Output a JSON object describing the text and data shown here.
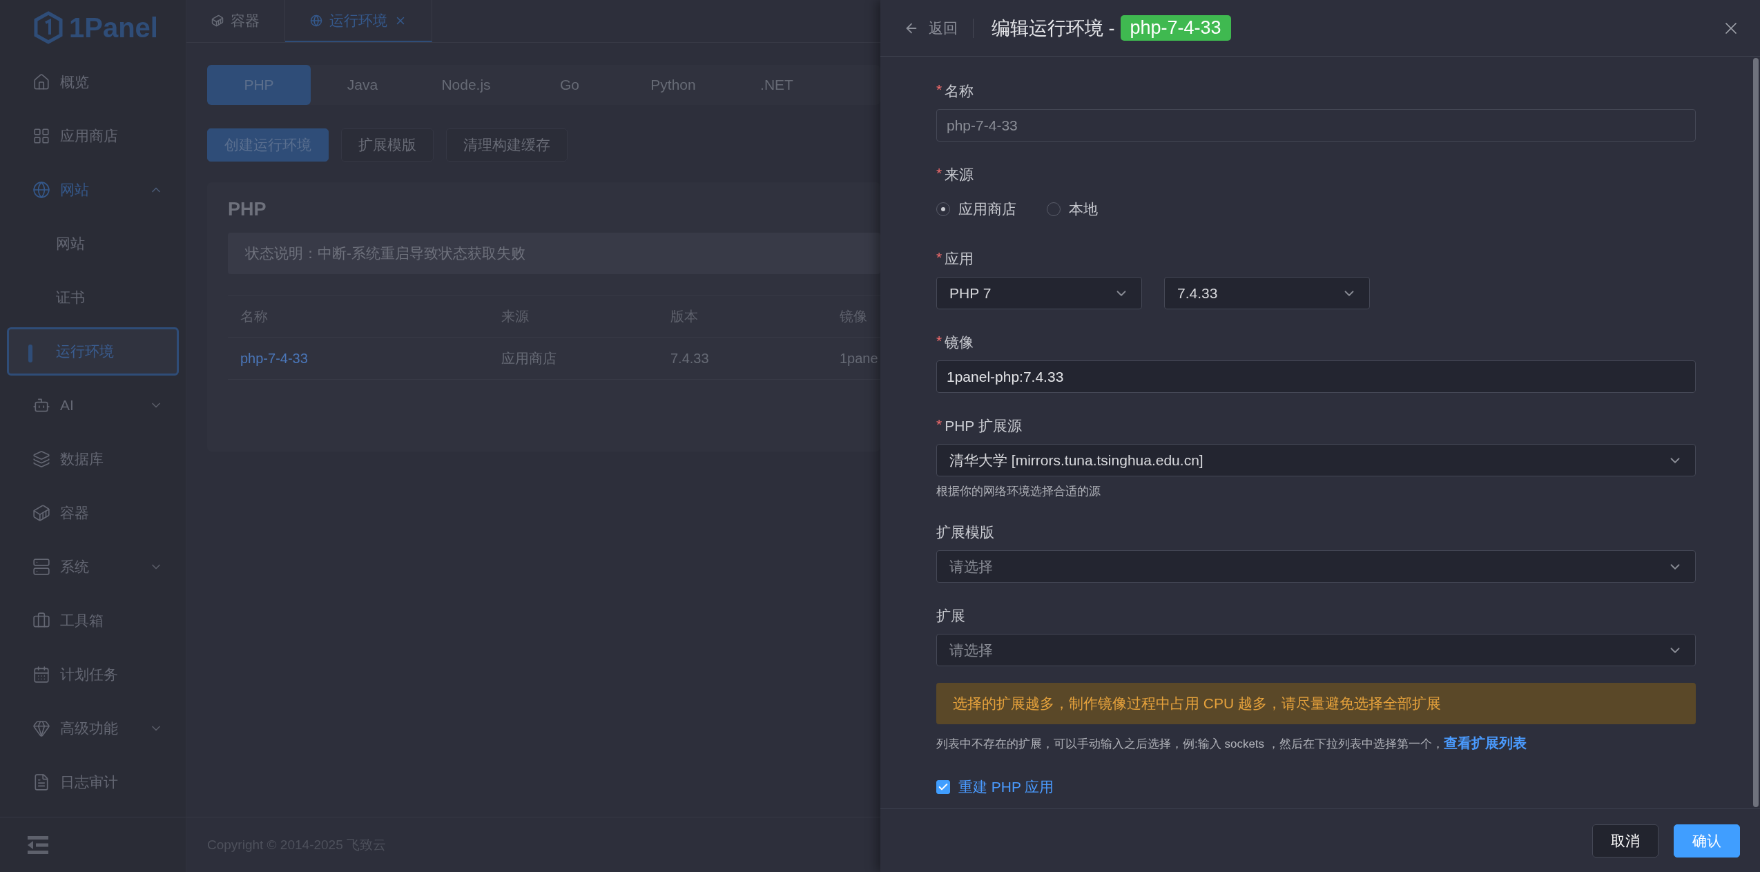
{
  "sidebar": {
    "logo": "1Panel",
    "items": [
      {
        "label": "概览",
        "selected": false
      },
      {
        "label": "应用商店",
        "selected": false
      },
      {
        "label": "网站",
        "selected": false,
        "expanded": true,
        "children": [
          {
            "label": "网站",
            "selected": false
          },
          {
            "label": "证书",
            "selected": false
          },
          {
            "label": "运行环境",
            "selected": true
          }
        ]
      },
      {
        "label": "AI",
        "selected": false,
        "expanded": false
      },
      {
        "label": "数据库",
        "selected": false
      },
      {
        "label": "容器",
        "selected": false
      },
      {
        "label": "系统",
        "selected": false,
        "expanded": false
      },
      {
        "label": "工具箱",
        "selected": false
      },
      {
        "label": "计划任务",
        "selected": false
      },
      {
        "label": "高级功能",
        "selected": false,
        "expanded": false
      },
      {
        "label": "日志审计",
        "selected": false
      }
    ]
  },
  "page_tabs": [
    {
      "label": "容器",
      "selected": false,
      "closable": false
    },
    {
      "label": "运行环境",
      "selected": true,
      "closable": true
    }
  ],
  "runtime_tabs": [
    {
      "label": "PHP",
      "selected": true
    },
    {
      "label": "Java",
      "selected": false
    },
    {
      "label": "Node.js",
      "selected": false
    },
    {
      "label": "Go",
      "selected": false
    },
    {
      "label": "Python",
      "selected": false
    },
    {
      "label": ".NET",
      "selected": false
    }
  ],
  "actions": [
    {
      "label": "创建运行环境",
      "primary": true
    },
    {
      "label": "扩展模版",
      "primary": false
    },
    {
      "label": "清理构建缓存",
      "primary": false
    }
  ],
  "card": {
    "title": "PHP",
    "notice": "状态说明：中断-系统重启导致状态获取失败",
    "table": {
      "columns": [
        "名称",
        "来源",
        "版本",
        "镜像"
      ],
      "rows": [
        [
          "php-7-4-33",
          "应用商店",
          "7.4.33",
          "1pane"
        ]
      ]
    }
  },
  "footer": "Copyright © 2014-2025 飞致云",
  "drawer": {
    "back": "返回",
    "title": "编辑运行环境 -",
    "badge": "php-7-4-33",
    "fields": [
      {
        "kind": "input",
        "label": "名称",
        "mark": "*",
        "value": "php-7-4-33",
        "disabled": true
      },
      {
        "kind": "radio",
        "label": "来源",
        "mark": "*",
        "options": [
          {
            "label": "应用商店",
            "selected": true
          },
          {
            "label": "本地",
            "selected": false
          }
        ]
      },
      {
        "kind": "selects",
        "label": "应用",
        "mark": "*",
        "selects": [
          {
            "value": "PHP 7"
          },
          {
            "value": "7.4.33"
          }
        ]
      },
      {
        "kind": "input",
        "label": "镜像",
        "mark": "*",
        "value": "1panel-php:7.4.33",
        "disabled": false
      },
      {
        "kind": "select",
        "label": "PHP 扩展源",
        "mark": "*",
        "value": "清华大学 [mirrors.tuna.tsinghua.edu.cn]",
        "hint": "根据你的网络环境选择合适的源"
      },
      {
        "kind": "select",
        "label": "扩展模版",
        "placeholder": "请选择"
      },
      {
        "kind": "select",
        "label": "扩展",
        "placeholder": "请选择"
      }
    ],
    "warning": "选择的扩展越多，制作镜像过程中占用 CPU 越多，请尽量避免选择全部扩展",
    "help": "列表中不存在的扩展，可以手动输入之后选择，例:输入 sockets ，然后在下拉列表中选择第一个，",
    "help_link": "查看扩展列表",
    "checkbox": {
      "label": "重建 PHP 应用",
      "checked": true
    },
    "buttons": [
      {
        "label": "取消",
        "primary": false
      },
      {
        "label": "确认",
        "primary": true
      }
    ]
  }
}
